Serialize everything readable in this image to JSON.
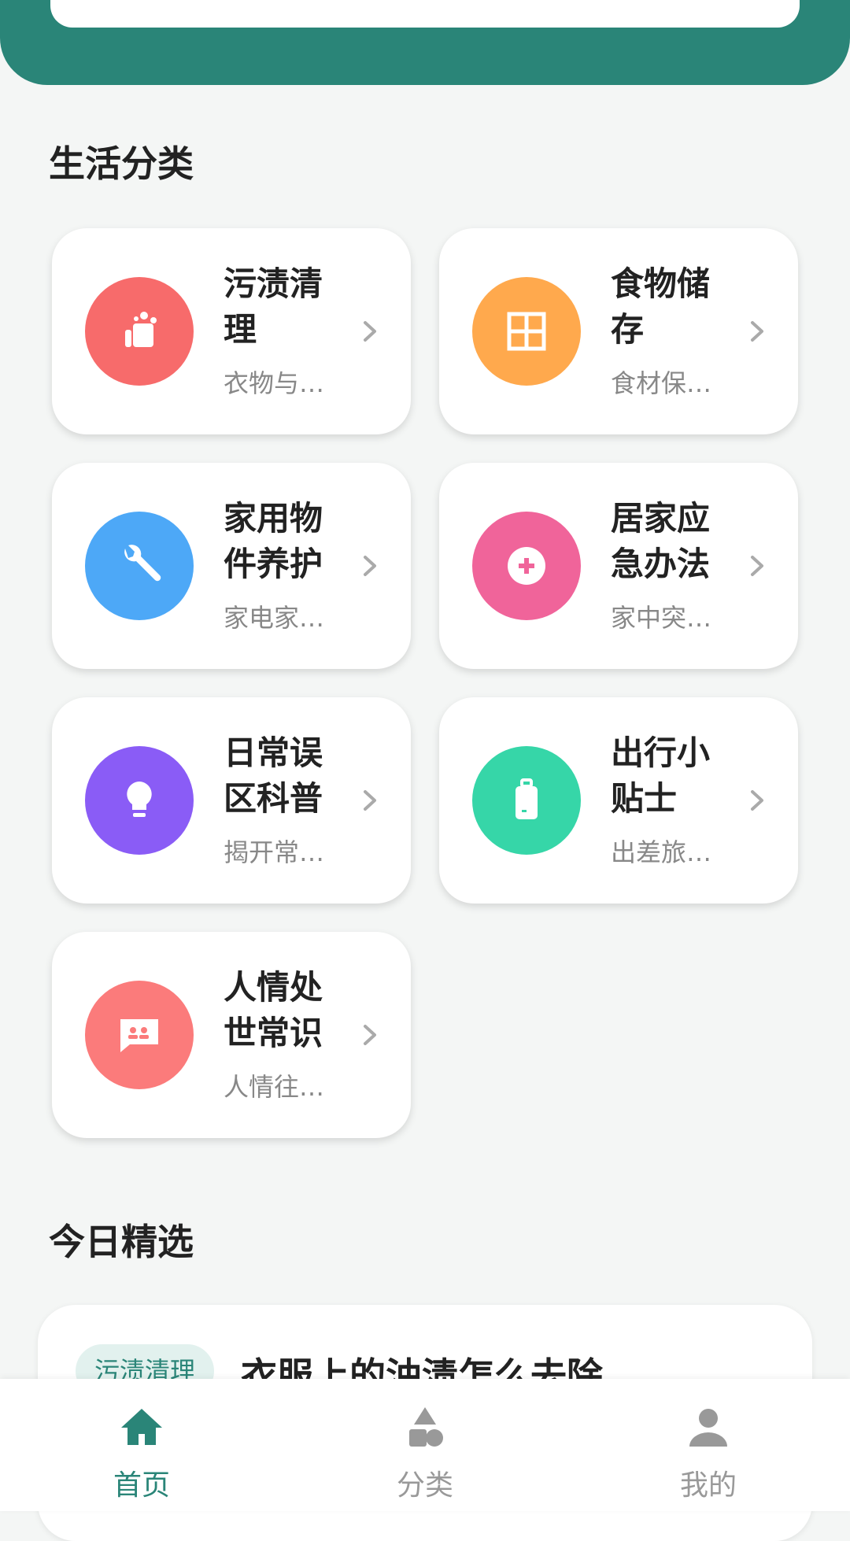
{
  "sections": {
    "categories_title": "生活分类",
    "featured_title": "今日精选"
  },
  "categories": [
    {
      "title": "污渍清理",
      "subtitle": "衣物与…",
      "color": "#f76b6b",
      "icon": "stain-clean-icon"
    },
    {
      "title": "食物储存",
      "subtitle": "食材保…",
      "color": "#ffa94d",
      "icon": "storage-grid-icon"
    },
    {
      "title": "家用物件养护",
      "subtitle": "家电家…",
      "color": "#4da8f7",
      "icon": "wrench-icon"
    },
    {
      "title": "居家应急办法",
      "subtitle": "家中突…",
      "color": "#f0649a",
      "icon": "first-aid-icon"
    },
    {
      "title": "日常误区科普",
      "subtitle": "揭开常…",
      "color": "#8a5cf6",
      "icon": "lightbulb-icon"
    },
    {
      "title": "出行小贴士",
      "subtitle": "出差旅…",
      "color": "#36d6a8",
      "icon": "luggage-icon"
    },
    {
      "title": "人情处世常识",
      "subtitle": "人情往…",
      "color": "#fb7b7b",
      "icon": "chat-people-icon"
    }
  ],
  "featured": {
    "tag": "污渍清理",
    "title": "衣服上的油渍怎么去除"
  },
  "tabbar": {
    "home": "首页",
    "category": "分类",
    "mine": "我的",
    "active_color": "#2a8578",
    "inactive_color": "#999999"
  }
}
